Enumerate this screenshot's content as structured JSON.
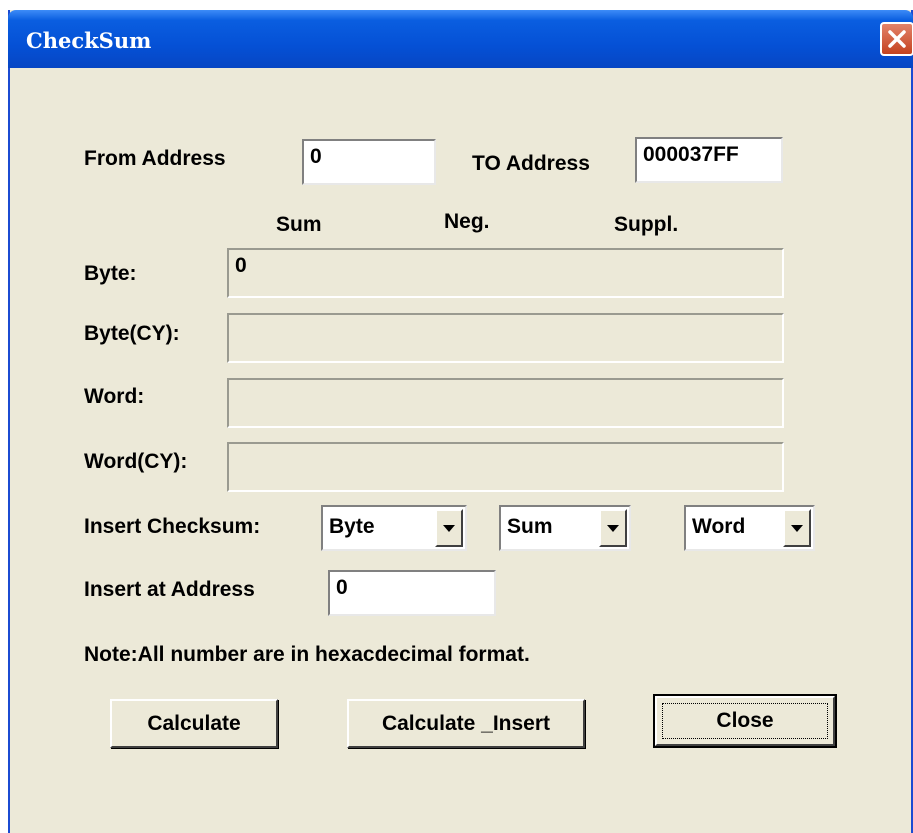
{
  "window": {
    "title": "CheckSum"
  },
  "range": {
    "from_label": "From Address",
    "from_value": "0",
    "to_label": "TO Address",
    "to_value": "000037FF"
  },
  "columns": {
    "sum": "Sum",
    "neg": "Neg.",
    "suppl": "Suppl."
  },
  "results": [
    {
      "label": "Byte:",
      "value": "0"
    },
    {
      "label": "Byte(CY):",
      "value": ""
    },
    {
      "label": "Word:",
      "value": ""
    },
    {
      "label": "Word(CY):",
      "value": ""
    }
  ],
  "insert": {
    "label": "Insert Checksum:",
    "size_select": "Byte",
    "type_select": "Sum",
    "unit_select": "Word",
    "address_label": "Insert at Address",
    "address_value": "0"
  },
  "note": "Note:All number are in hexacdecimal format.",
  "buttons": {
    "calculate": "Calculate",
    "calculate_insert": "Calculate _Insert",
    "close": "Close"
  },
  "colors": {
    "titlebar": "#0551d6",
    "dialog_bg": "#ece9d8",
    "close_button": "#c4421f"
  }
}
